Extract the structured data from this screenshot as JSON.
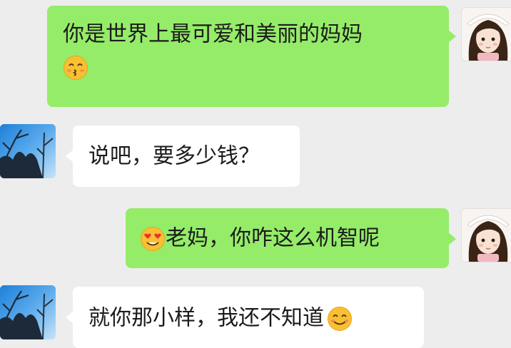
{
  "chat": {
    "messages": [
      {
        "sender": "me",
        "text": "你是世界上最可爱和美丽的妈妈",
        "emoji": "kissing-face-emoji"
      },
      {
        "sender": "them",
        "text": "说吧，要多少钱？"
      },
      {
        "sender": "me",
        "text": "老妈，你咋这么机智呢",
        "emoji": "heart-eyes-emoji"
      },
      {
        "sender": "them",
        "text": "就你那小样，我还不知道",
        "emoji": "smiling-face-emoji"
      }
    ]
  },
  "colors": {
    "background": "#ededed",
    "my_bubble": "#95ec69",
    "their_bubble": "#ffffff",
    "text": "#1b1b1b"
  },
  "icons": {
    "my_avatar": "girl-avatar-icon",
    "their_avatar": "sky-tree-avatar-icon"
  }
}
